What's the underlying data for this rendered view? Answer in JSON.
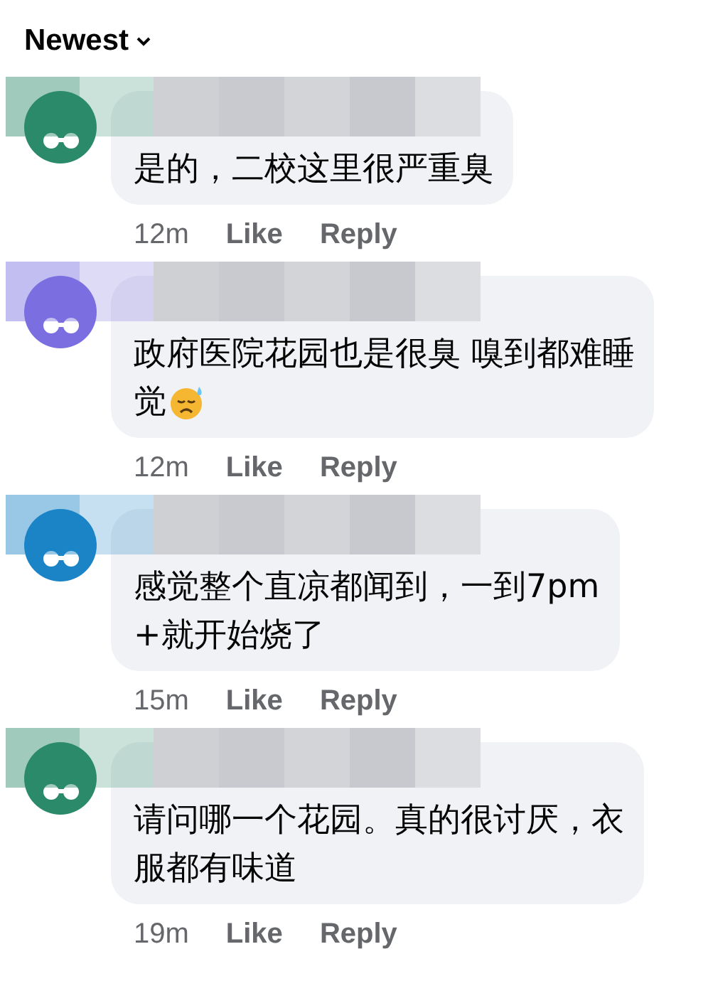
{
  "sort_menu": {
    "label": "Newest"
  },
  "comments": [
    {
      "color": "#2a8a6a",
      "text_lines": [
        "是的，二校这里很严重臭"
      ],
      "sweat_emoji": false,
      "time": "12m",
      "like": "Like",
      "reply": "Reply"
    },
    {
      "color": "#7b6ee0",
      "text_lines": [
        "政府医院花园也是很臭 嗅到都难睡",
        "觉"
      ],
      "sweat_emoji": true,
      "time": "12m",
      "like": "Like",
      "reply": "Reply"
    },
    {
      "color": "#1a84c7",
      "text_lines": [
        "感觉整个直凉都闻到，一到7pm",
        "+就开始烧了"
      ],
      "sweat_emoji": false,
      "time": "15m",
      "like": "Like",
      "reply": "Reply"
    },
    {
      "color": "#2a8a6a",
      "text_lines": [
        "请问哪一个花园。真的很讨厌，衣",
        "服都有味道"
      ],
      "sweat_emoji": false,
      "time": "19m",
      "like": "Like",
      "reply": "Reply"
    }
  ]
}
